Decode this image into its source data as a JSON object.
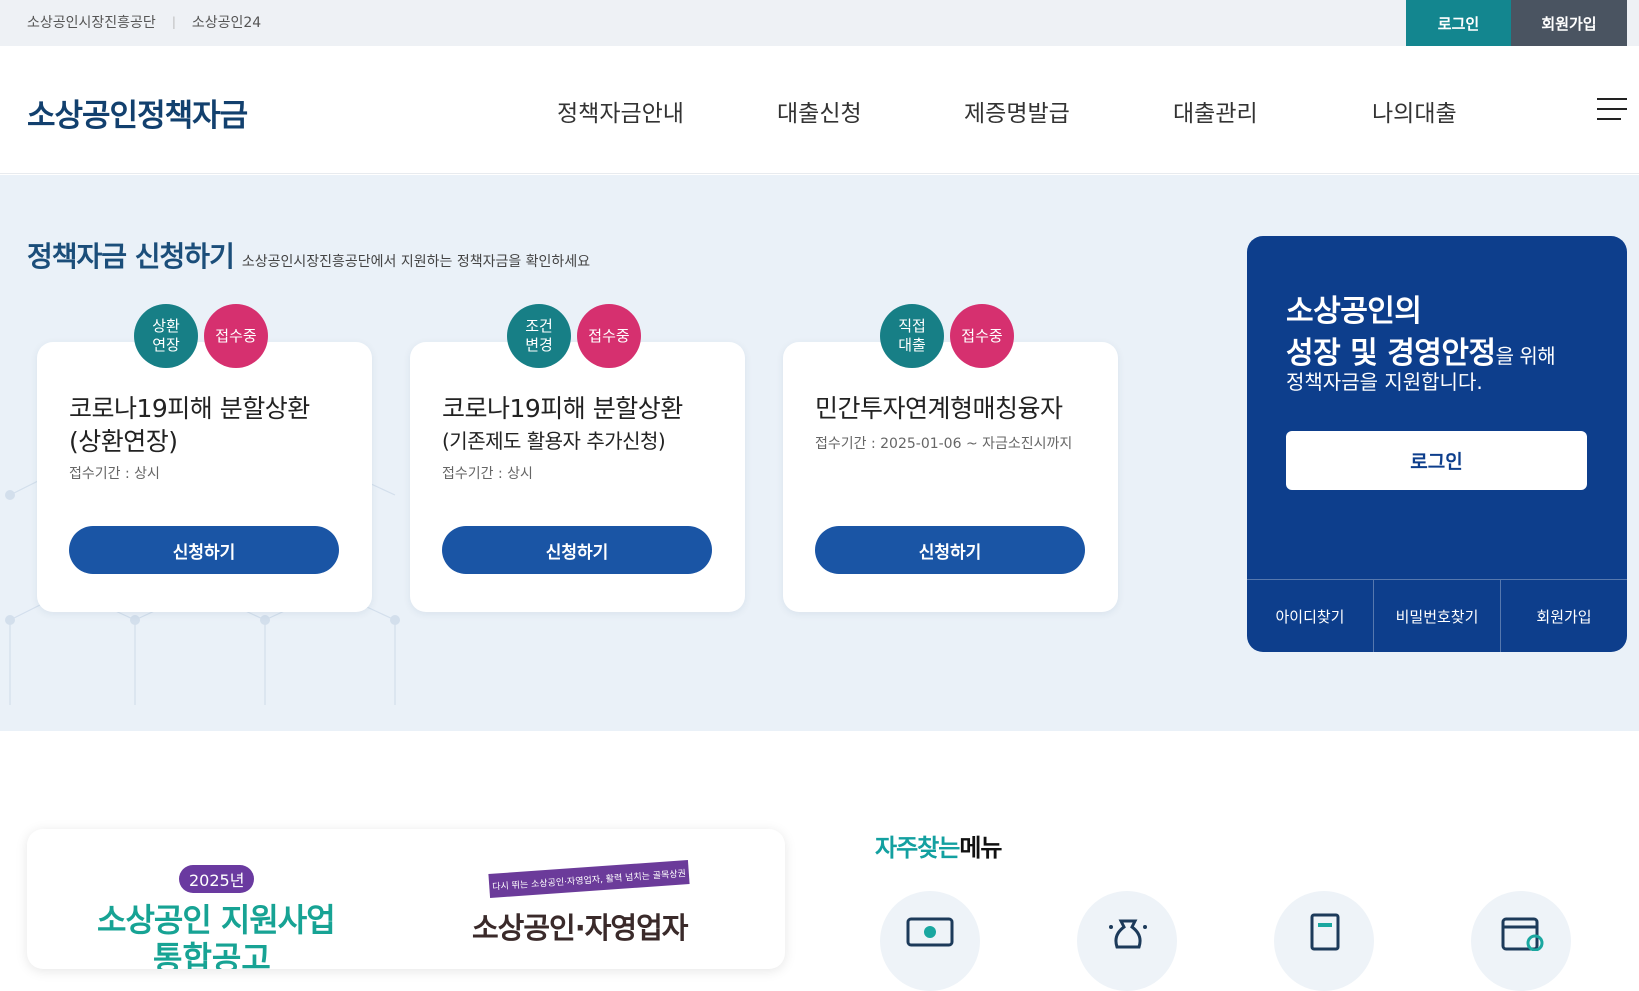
{
  "topbar": {
    "link1": "소상공인시장진흥공단",
    "separator": "|",
    "link2": "소상공인24",
    "login": "로그인",
    "join": "회원가입"
  },
  "header": {
    "logo": "소상공인정책자금",
    "nav": [
      "정책자금안내",
      "대출신청",
      "제증명발급",
      "대출관리",
      "나의대출"
    ]
  },
  "section": {
    "title": "정책자금 신청하기",
    "desc": "소상공인시장진흥공단에서 지원하는 정책자금을 확인하세요"
  },
  "cards": [
    {
      "type_line1": "상환",
      "type_line2": "연장",
      "status": "접수중",
      "title_line1": "코로나19피해 분할상환",
      "title_line2": "(상환연장)",
      "period": "접수기간 : 상시",
      "button": "신청하기"
    },
    {
      "type_line1": "조건",
      "type_line2": "변경",
      "status": "접수중",
      "title_line1": "코로나19피해 분할상환",
      "title_line2": "(기존제도 활용자 추가신청)",
      "period": "접수기간 : 상시",
      "button": "신청하기"
    },
    {
      "type_line1": "직접",
      "type_line2": "대출",
      "status": "접수중",
      "title_line1": "민간투자연계형매칭융자",
      "period": "접수기간 : 2025-01-06 ~ 자금소진시까지",
      "button": "신청하기"
    }
  ],
  "loginbox": {
    "line1": "소상공인의",
    "line2_bold": "성장 및 경영안정",
    "line2_rest": "을 위해",
    "line3": "정책자금을 지원합니다.",
    "button": "로그인",
    "links": [
      "아이디찾기",
      "비밀번호찾기",
      "회원가입"
    ]
  },
  "banner": {
    "year": "2025년",
    "left_title": "소상공인 지원사업",
    "left_title2": "통합공고",
    "ribbon": "다시 뛰는 소상공인·자영업자, 활력 넘치는 골목상권",
    "right_title": "소상공인·자영업자"
  },
  "favorites": {
    "title_a": "자주찾는",
    "title_b": "메뉴",
    "icons": [
      "money-icon",
      "money-bag-icon",
      "document-icon",
      "calendar-icon"
    ]
  },
  "colors": {
    "brand_navy": "#12406e",
    "teal": "#13868f",
    "status_pink": "#d6306f",
    "apply_blue": "#1a55a5",
    "login_box": "#0d3e8c"
  }
}
